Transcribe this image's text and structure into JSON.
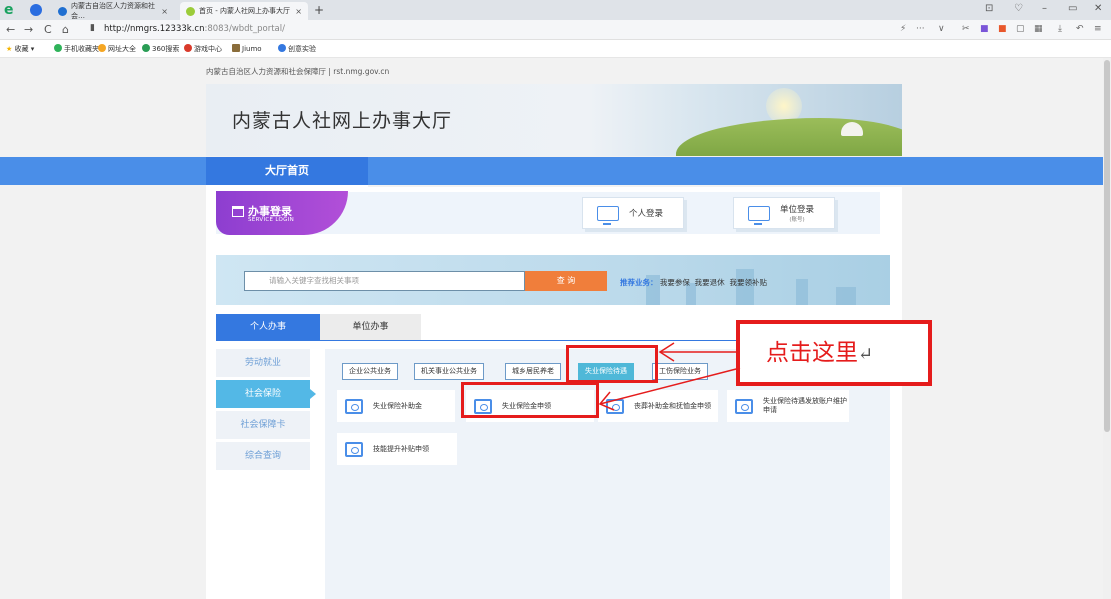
{
  "browser": {
    "tabs": [
      {
        "title": "内蒙古自治区人力资源和社会…",
        "active": false
      },
      {
        "title": "首页 - 内蒙人社网上办事大厅",
        "active": true
      }
    ],
    "url_host": "http://nmgrs.12333k.cn",
    "url_path": ":8083/wbdt_portal/",
    "bookmarks": [
      "收藏",
      "手机收藏夹",
      "网址大全",
      "360搜索",
      "游戏中心",
      "Jiumo",
      "创意实验"
    ]
  },
  "site": {
    "topline": "内蒙古自治区人力资源和社会保障厅  |  rst.nmg.gov.cn",
    "title": "内蒙古人社网上办事大厅",
    "nav_home": "大厅首页"
  },
  "login": {
    "badge_title": "办事登录",
    "badge_sub": "SERVICE LOGIN",
    "personal": "个人登录",
    "unit": "单位登录",
    "unit_sub": "(账号)"
  },
  "search": {
    "placeholder": "请输入关键字查找相关事项",
    "button": "查 询",
    "recommend_label": "推荐业务：",
    "recommend_items": [
      "我要参保",
      "我要退休",
      "我要领补贴"
    ]
  },
  "tabs": {
    "personal": "个人办事",
    "unit": "单位办事"
  },
  "sidemenu": [
    "劳动就业",
    "社会保险",
    "社会保障卡",
    "综合查询"
  ],
  "subtabs": [
    "企业公共业务",
    "机关事业公共业务",
    "城乡居民养老",
    "失业保险待遇",
    "工伤保险业务"
  ],
  "services": [
    "失业保险补助金",
    "失业保险金申领",
    "丧葬补助金和抚恤金申领",
    "失业保险待遇发放账户维护申请",
    "技能提升补贴申领"
  ],
  "annotation": {
    "text": "点击这里",
    "mark": "↵"
  },
  "colors": {
    "accent_blue": "#4a8ee8",
    "highlight_red": "#e51c1c",
    "search_orange": "#f07e3b",
    "active_side": "#53b8e6"
  }
}
